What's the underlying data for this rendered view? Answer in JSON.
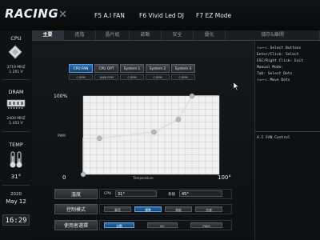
{
  "header": {
    "logo": "RACING",
    "f5": "F5 A.I FAN",
    "f6": "F6 Vivid Led DJ",
    "f7": "F7 EZ Mode"
  },
  "tabs": [
    "主要",
    "進階",
    "晶片組",
    "啟動",
    "安全",
    "優化",
    "儲存&離開"
  ],
  "sidebar": {
    "cpu_title": "CPU",
    "cpu_freq": "3719 MHZ",
    "cpu_volt": "1.201 V",
    "dram_title": "DRAM",
    "dram_freq": "2400 MHZ",
    "dram_volt": "1.453 V",
    "temp_title": "TEMP",
    "temp_value": "31°",
    "year": "2020",
    "date": "May 12",
    "time": "16:29"
  },
  "fans": [
    {
      "label": "CPU FAN",
      "rpm": "0 RPM"
    },
    {
      "label": "CPU OPT",
      "rpm": "1666 RPM"
    },
    {
      "label": "System 1",
      "rpm": "0 RPM"
    },
    {
      "label": "System 2",
      "rpm": "0 RPM"
    },
    {
      "label": "System 3",
      "rpm": "0 RPM"
    }
  ],
  "chart_data": {
    "type": "line",
    "ylabel": "PWM",
    "xlabel": "Temperature",
    "y_max_label": "100%",
    "x_min_label": "0",
    "x_max_label": "100°",
    "xlim": [
      0,
      100
    ],
    "ylim": [
      0,
      100
    ],
    "series": [
      {
        "values": [
          [
            0,
            0
          ],
          [
            0,
            46
          ],
          [
            12,
            46
          ],
          [
            52,
            54
          ],
          [
            70,
            70
          ],
          [
            80,
            100
          ],
          [
            100,
            100
          ]
        ]
      }
    ],
    "control_points": [
      [
        12,
        46
      ],
      [
        52,
        54
      ],
      [
        70,
        70
      ],
      [
        80,
        100
      ]
    ],
    "grid": true
  },
  "rows": {
    "temperature_label": "溫度",
    "cpu_label": "CPU",
    "cpu_value": "31°",
    "sys_label": "系統",
    "sys_value": "45°",
    "control_label": "控制模式",
    "control_options": [
      "靜音",
      "標準",
      "效能",
      "全速"
    ],
    "user_label": "使用者選擇",
    "user_options": [
      "自動",
      "DC",
      "PWM"
    ]
  },
  "help": {
    "lines": [
      "↑↓←→: Select Buttons",
      "Enter/Click: Select",
      "ESC/Right Click: Exit",
      "Manual Mode:",
      "Tab: Select Dots",
      "↑↓←→: Move Dots"
    ],
    "section_title": "A.I FAN Control"
  },
  "colors": {
    "accent": "#2a6fb3",
    "curve": "#dcdcdc",
    "point": "#b8b8b8"
  }
}
